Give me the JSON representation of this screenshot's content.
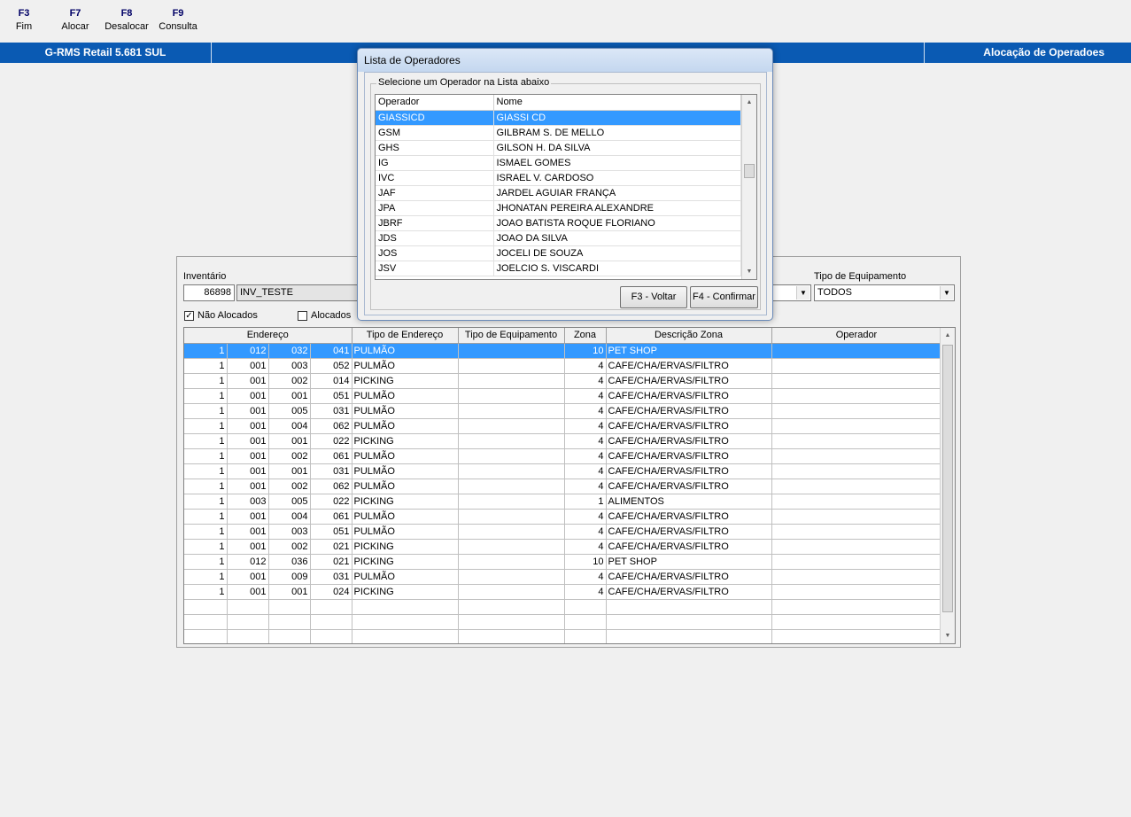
{
  "toolbar": {
    "keys": [
      {
        "key": "F3",
        "label": "Fim"
      },
      {
        "key": "F7",
        "label": "Alocar"
      },
      {
        "key": "F8",
        "label": "Desalocar"
      },
      {
        "key": "F9",
        "label": "Consulta"
      }
    ]
  },
  "titlebar": {
    "app_name": "G-RMS Retail 5.681 SUL",
    "screen_title": "Alocação de Operadoes"
  },
  "form": {
    "inventory_label": "Inventário",
    "inventory_code": "86898",
    "inventory_name": "INV_TESTE",
    "equipment_type_label": "Tipo de Equipamento",
    "equipment_type_value": "TODOS",
    "filter_not_allocated_label": "Não Alocados",
    "filter_not_allocated_checked": true,
    "filter_allocated_label": "Alocados",
    "filter_allocated_checked": false
  },
  "grid": {
    "headers": [
      "Endereço",
      "Tipo de Endereço",
      "Tipo de Equipamento",
      "Zona",
      "Descrição Zona",
      "Operador"
    ],
    "rows": [
      [
        "1",
        "012",
        "032",
        "041",
        "PULMÃO",
        "",
        "10",
        "PET SHOP",
        ""
      ],
      [
        "1",
        "001",
        "003",
        "052",
        "PULMÃO",
        "",
        "4",
        "CAFE/CHA/ERVAS/FILTRO",
        ""
      ],
      [
        "1",
        "001",
        "002",
        "014",
        "PICKING",
        "",
        "4",
        "CAFE/CHA/ERVAS/FILTRO",
        ""
      ],
      [
        "1",
        "001",
        "001",
        "051",
        "PULMÃO",
        "",
        "4",
        "CAFE/CHA/ERVAS/FILTRO",
        ""
      ],
      [
        "1",
        "001",
        "005",
        "031",
        "PULMÃO",
        "",
        "4",
        "CAFE/CHA/ERVAS/FILTRO",
        ""
      ],
      [
        "1",
        "001",
        "004",
        "062",
        "PULMÃO",
        "",
        "4",
        "CAFE/CHA/ERVAS/FILTRO",
        ""
      ],
      [
        "1",
        "001",
        "001",
        "022",
        "PICKING",
        "",
        "4",
        "CAFE/CHA/ERVAS/FILTRO",
        ""
      ],
      [
        "1",
        "001",
        "002",
        "061",
        "PULMÃO",
        "",
        "4",
        "CAFE/CHA/ERVAS/FILTRO",
        ""
      ],
      [
        "1",
        "001",
        "001",
        "031",
        "PULMÃO",
        "",
        "4",
        "CAFE/CHA/ERVAS/FILTRO",
        ""
      ],
      [
        "1",
        "001",
        "002",
        "062",
        "PULMÃO",
        "",
        "4",
        "CAFE/CHA/ERVAS/FILTRO",
        ""
      ],
      [
        "1",
        "003",
        "005",
        "022",
        "PICKING",
        "",
        "1",
        "ALIMENTOS",
        ""
      ],
      [
        "1",
        "001",
        "004",
        "061",
        "PULMÃO",
        "",
        "4",
        "CAFE/CHA/ERVAS/FILTRO",
        ""
      ],
      [
        "1",
        "001",
        "003",
        "051",
        "PULMÃO",
        "",
        "4",
        "CAFE/CHA/ERVAS/FILTRO",
        ""
      ],
      [
        "1",
        "001",
        "002",
        "021",
        "PICKING",
        "",
        "4",
        "CAFE/CHA/ERVAS/FILTRO",
        ""
      ],
      [
        "1",
        "012",
        "036",
        "021",
        "PICKING",
        "",
        "10",
        "PET SHOP",
        ""
      ],
      [
        "1",
        "001",
        "009",
        "031",
        "PULMÃO",
        "",
        "4",
        "CAFE/CHA/ERVAS/FILTRO",
        ""
      ],
      [
        "1",
        "001",
        "001",
        "024",
        "PICKING",
        "",
        "4",
        "CAFE/CHA/ERVAS/FILTRO",
        ""
      ]
    ],
    "selected_row": 0
  },
  "dialog": {
    "title": "Lista de Operadores",
    "group_label": "Selecione um Operador na Lista abaixo",
    "columns": [
      "Operador",
      "Nome"
    ],
    "operators": [
      [
        "GIASSICD",
        "GIASSI CD"
      ],
      [
        "GSM",
        "GILBRAM S. DE MELLO"
      ],
      [
        "GHS",
        "GILSON H. DA SILVA"
      ],
      [
        "IG",
        "ISMAEL GOMES"
      ],
      [
        "IVC",
        "ISRAEL V. CARDOSO"
      ],
      [
        "JAF",
        "JARDEL AGUIAR FRANÇA"
      ],
      [
        "JPA",
        "JHONATAN PEREIRA ALEXANDRE"
      ],
      [
        "JBRF",
        "JOAO BATISTA ROQUE FLORIANO"
      ],
      [
        "JDS",
        "JOAO DA SILVA"
      ],
      [
        "JOS",
        "JOCELI DE SOUZA"
      ],
      [
        "JSV",
        "JOELCIO S. VISCARDI"
      ]
    ],
    "selected_row": 0,
    "back_button": "F3 - Voltar",
    "confirm_button": "F4 - Confirmar"
  },
  "colors": {
    "titlebar": "#0a5ab3",
    "selection": "#3399ff",
    "fkey": "#000066"
  }
}
